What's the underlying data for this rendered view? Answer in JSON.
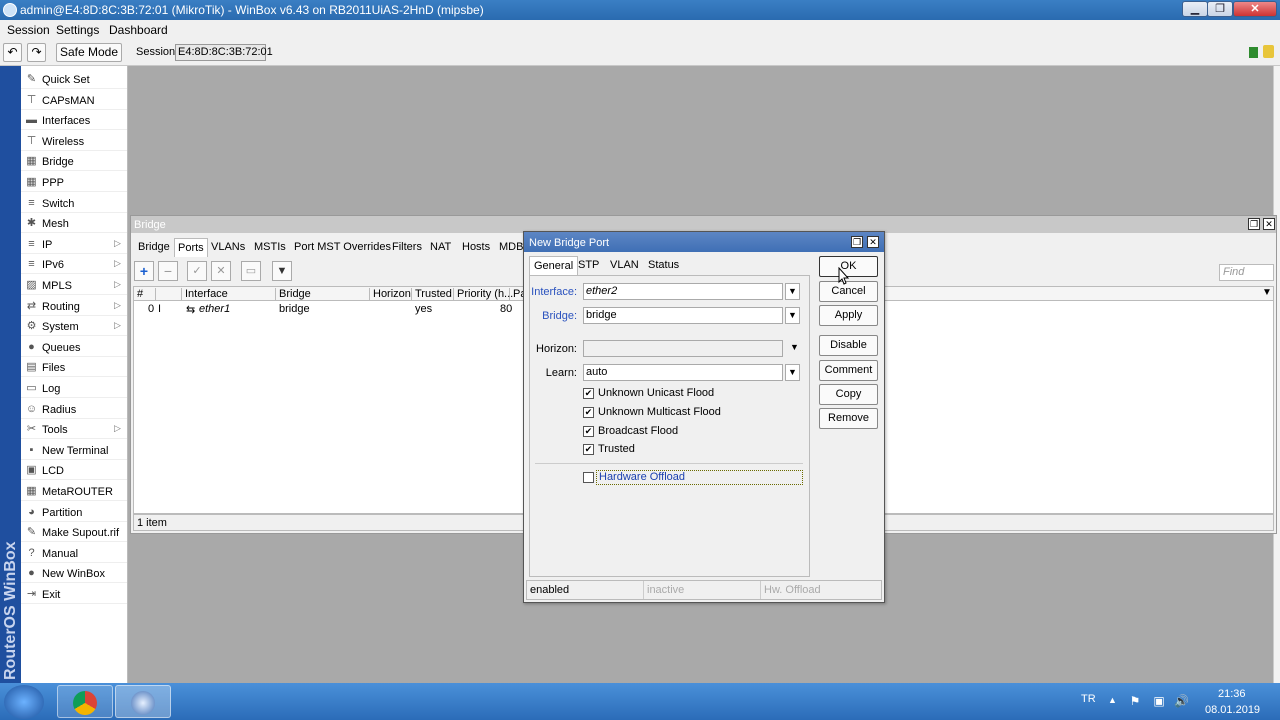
{
  "window": {
    "title": "admin@E4:8D:8C:3B:72:01 (MikroTik) - WinBox v6.43 on RB2011UiAS-2HnD (mipsbe)",
    "min": "▁",
    "max": "❐",
    "close": "✕"
  },
  "menu": [
    "Session",
    "Settings",
    "Dashboard"
  ],
  "toolbar": {
    "undo": "↶",
    "redo": "↷",
    "safe_mode": "Safe Mode",
    "session_label": "Session:",
    "session_value": "E4:8D:8C:3B:72:01"
  },
  "vertical_brand": "RouterOS WinBox",
  "sidebar": {
    "items": [
      {
        "label": "Quick Set",
        "icon": "quick-set-icon",
        "glyph": "✎",
        "arrow": ""
      },
      {
        "label": "CAPsMAN",
        "icon": "capsman-icon",
        "glyph": "⊤",
        "arrow": ""
      },
      {
        "label": "Interfaces",
        "icon": "interfaces-icon",
        "glyph": "▬",
        "arrow": ""
      },
      {
        "label": "Wireless",
        "icon": "wireless-icon",
        "glyph": "⊤",
        "arrow": ""
      },
      {
        "label": "Bridge",
        "icon": "bridge-icon",
        "glyph": "▦",
        "arrow": ""
      },
      {
        "label": "PPP",
        "icon": "ppp-icon",
        "glyph": "▦",
        "arrow": ""
      },
      {
        "label": "Switch",
        "icon": "switch-icon",
        "glyph": "≡",
        "arrow": ""
      },
      {
        "label": "Mesh",
        "icon": "mesh-icon",
        "glyph": "✱",
        "arrow": ""
      },
      {
        "label": "IP",
        "icon": "ip-icon",
        "glyph": "≡",
        "arrow": "▷"
      },
      {
        "label": "IPv6",
        "icon": "ipv6-icon",
        "glyph": "≡",
        "arrow": "▷"
      },
      {
        "label": "MPLS",
        "icon": "mpls-icon",
        "glyph": "▨",
        "arrow": "▷"
      },
      {
        "label": "Routing",
        "icon": "routing-icon",
        "glyph": "⇄",
        "arrow": "▷"
      },
      {
        "label": "System",
        "icon": "system-icon",
        "glyph": "⚙",
        "arrow": "▷"
      },
      {
        "label": "Queues",
        "icon": "queues-icon",
        "glyph": "●",
        "arrow": ""
      },
      {
        "label": "Files",
        "icon": "files-icon",
        "glyph": "▤",
        "arrow": ""
      },
      {
        "label": "Log",
        "icon": "log-icon",
        "glyph": "▭",
        "arrow": ""
      },
      {
        "label": "Radius",
        "icon": "radius-icon",
        "glyph": "☺",
        "arrow": ""
      },
      {
        "label": "Tools",
        "icon": "tools-icon",
        "glyph": "✂",
        "arrow": "▷"
      },
      {
        "label": "New Terminal",
        "icon": "terminal-icon",
        "glyph": "▪",
        "arrow": ""
      },
      {
        "label": "LCD",
        "icon": "lcd-icon",
        "glyph": "▣",
        "arrow": ""
      },
      {
        "label": "MetaROUTER",
        "icon": "metarouter-icon",
        "glyph": "▦",
        "arrow": ""
      },
      {
        "label": "Partition",
        "icon": "partition-icon",
        "glyph": "◕",
        "arrow": ""
      },
      {
        "label": "Make Supout.rif",
        "icon": "supout-icon",
        "glyph": "✎",
        "arrow": ""
      },
      {
        "label": "Manual",
        "icon": "manual-icon",
        "glyph": "?",
        "arrow": ""
      },
      {
        "label": "New WinBox",
        "icon": "winbox-icon",
        "glyph": "●",
        "arrow": ""
      },
      {
        "label": "Exit",
        "icon": "exit-icon",
        "glyph": "⇥",
        "arrow": ""
      }
    ]
  },
  "bridge_window": {
    "title": "Bridge",
    "restore": "❐",
    "close": "✕",
    "tabs": [
      "Bridge",
      "Ports",
      "VLANs",
      "MSTIs",
      "Port MST Overrides",
      "Filters",
      "NAT",
      "Hosts",
      "MDB"
    ],
    "active_tab": "Ports",
    "tool_glyphs": {
      "add": "+",
      "remove": "−",
      "enable": "✓",
      "disable": "✕",
      "comment": "▭",
      "filter": "▼"
    },
    "find_placeholder": "Find",
    "grid_dropdown": "▼",
    "columns": [
      "#",
      "Interface",
      "Bridge",
      "Horizon",
      "Trusted",
      "Priority (h...",
      "Pa"
    ],
    "rows": [
      {
        "num": "0",
        "flag": "I",
        "icon": "⇆",
        "interface": "ether1",
        "bridge": "bridge",
        "horizon": "",
        "trusted": "yes",
        "priority": "80"
      }
    ],
    "status": "1 item"
  },
  "dialog": {
    "title": "New Bridge Port",
    "restore": "❐",
    "close": "✕",
    "tabs": [
      "General",
      "STP",
      "VLAN",
      "Status"
    ],
    "active_tab": "General",
    "dropdown_glyph": "▼",
    "fields": {
      "interface_label": "Interface:",
      "interface_value": "ether2",
      "bridge_label": "Bridge:",
      "bridge_value": "bridge",
      "horizon_label": "Horizon:",
      "horizon_value": "",
      "learn_label": "Learn:",
      "learn_value": "auto"
    },
    "checkboxes": [
      {
        "label": "Unknown Unicast Flood",
        "checked": true
      },
      {
        "label": "Unknown Multicast Flood",
        "checked": true
      },
      {
        "label": "Broadcast Flood",
        "checked": true
      },
      {
        "label": "Trusted",
        "checked": true
      }
    ],
    "check_glyph": "✔",
    "hardware_offload": {
      "label": "Hardware Offload",
      "checked": false
    },
    "buttons": [
      "OK",
      "Cancel",
      "Apply",
      "Disable",
      "Comment",
      "Copy",
      "Remove"
    ],
    "status": [
      "enabled",
      "inactive",
      "Hw. Offload"
    ]
  },
  "taskbar": {
    "language": "TR",
    "tray_up": "▲",
    "tray_icons": [
      "⚑",
      "▣",
      "🔊"
    ],
    "time": "21:36",
    "date": "08.01.2019"
  }
}
